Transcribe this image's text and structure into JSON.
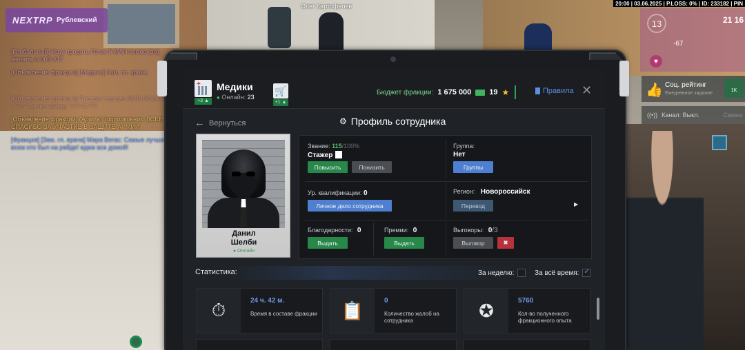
{
  "hud": {
    "server_brand": "NEXTRP",
    "server_city": "Рублевский",
    "player_tag": "Олег Картофелев",
    "topbar": "20:00 | 03.06.2025 | P.LOSS: 0% | ID: 233182 | PIN",
    "level": "13",
    "money": "21 16",
    "hp": "-67",
    "rating_title": "Соц. рейтинг",
    "rating_sub": "Ежедневное задание",
    "rating_badge": "1K",
    "channel_label": "Канал: Выкл.",
    "channel_extra": "Смена"
  },
  "chat": [
    {
      "text": "[Глобальный] Ищу продать Гелик 5 МЛН вызов (аа), звонить 5 000 947",
      "tone": "pink"
    },
    {
      "text": "[Объявление фракции] [Медики] Зам. гл. врача",
      "tone": "pink"
    },
    {
      "text": "...",
      "tone": "faded"
    },
    {
      "text": "[Объявление фракции] Продам Черную БМВ НОМЕРА 7 777 8м по номеру 7777С777",
      "tone": "faded"
    },
    {
      "text": "[Объявление фракции] (Армия)Подполковник: ВСЕМ СПАСИБО ЗА УЧАСТИЕ В ЗАЩИТЕ АРМИИ",
      "tone": "gold"
    },
    {
      "text": "[Фракция] [Зам. гл. врача] Мара Вегас: Самые лучшие всем кто был на рейде! едем все домой!",
      "tone": "blue"
    }
  ],
  "header": {
    "faction_name": "Медики",
    "online_label": "Онлайн:",
    "online_count": "23",
    "faction_badge": "+3",
    "cart_badge": "+1",
    "budget_label": "Бюджет фракции:",
    "budget_sum": "1 675 000",
    "stars": "19",
    "rules_label": "Правила",
    "close_icon": "close-icon"
  },
  "profile": {
    "back_label": "Вернуться",
    "title": "Профиль сотрудника",
    "first_name": "Данил",
    "last_name": "Шелби",
    "status": "Онлайн"
  },
  "info": {
    "rank_label": "Звание:",
    "rank_points": "115",
    "rank_max": "/100%",
    "rank_value": "Стажер",
    "promote": "Повысить",
    "demote": "Понизить",
    "group_label": "Группа:",
    "group_value": "Нет",
    "groups_btn": "Группы",
    "qual_label": "Ур. квалификации:",
    "qual_value": "0",
    "personal_file": "Личное дело сотрудника",
    "region_label": "Регион:",
    "region_value": "Новороссийск",
    "transfer": "Перевод",
    "thanks_label": "Благодарности:",
    "thanks_value": "0",
    "thanks_btn": "Выдать",
    "bonus_label": "Премии:",
    "bonus_value": "0",
    "bonus_btn": "Выдать",
    "warn_label": "Выговоры:",
    "warn_value": "0",
    "warn_max": "/3",
    "warn_btn": "Выговор"
  },
  "stats": {
    "label": "Статистика:",
    "week": "За неделю:",
    "all": "За всё время:",
    "cards": [
      {
        "value": "24 ч. 42 м.",
        "desc": "Время в составе фракции",
        "icon": "stopwatch-icon"
      },
      {
        "value": "0",
        "desc": "Количество жалоб на сотрудника",
        "icon": "complaint-icon"
      },
      {
        "value": "5760",
        "desc": "Кол-во полученного фракционного опыта",
        "icon": "exp-icon"
      }
    ]
  }
}
